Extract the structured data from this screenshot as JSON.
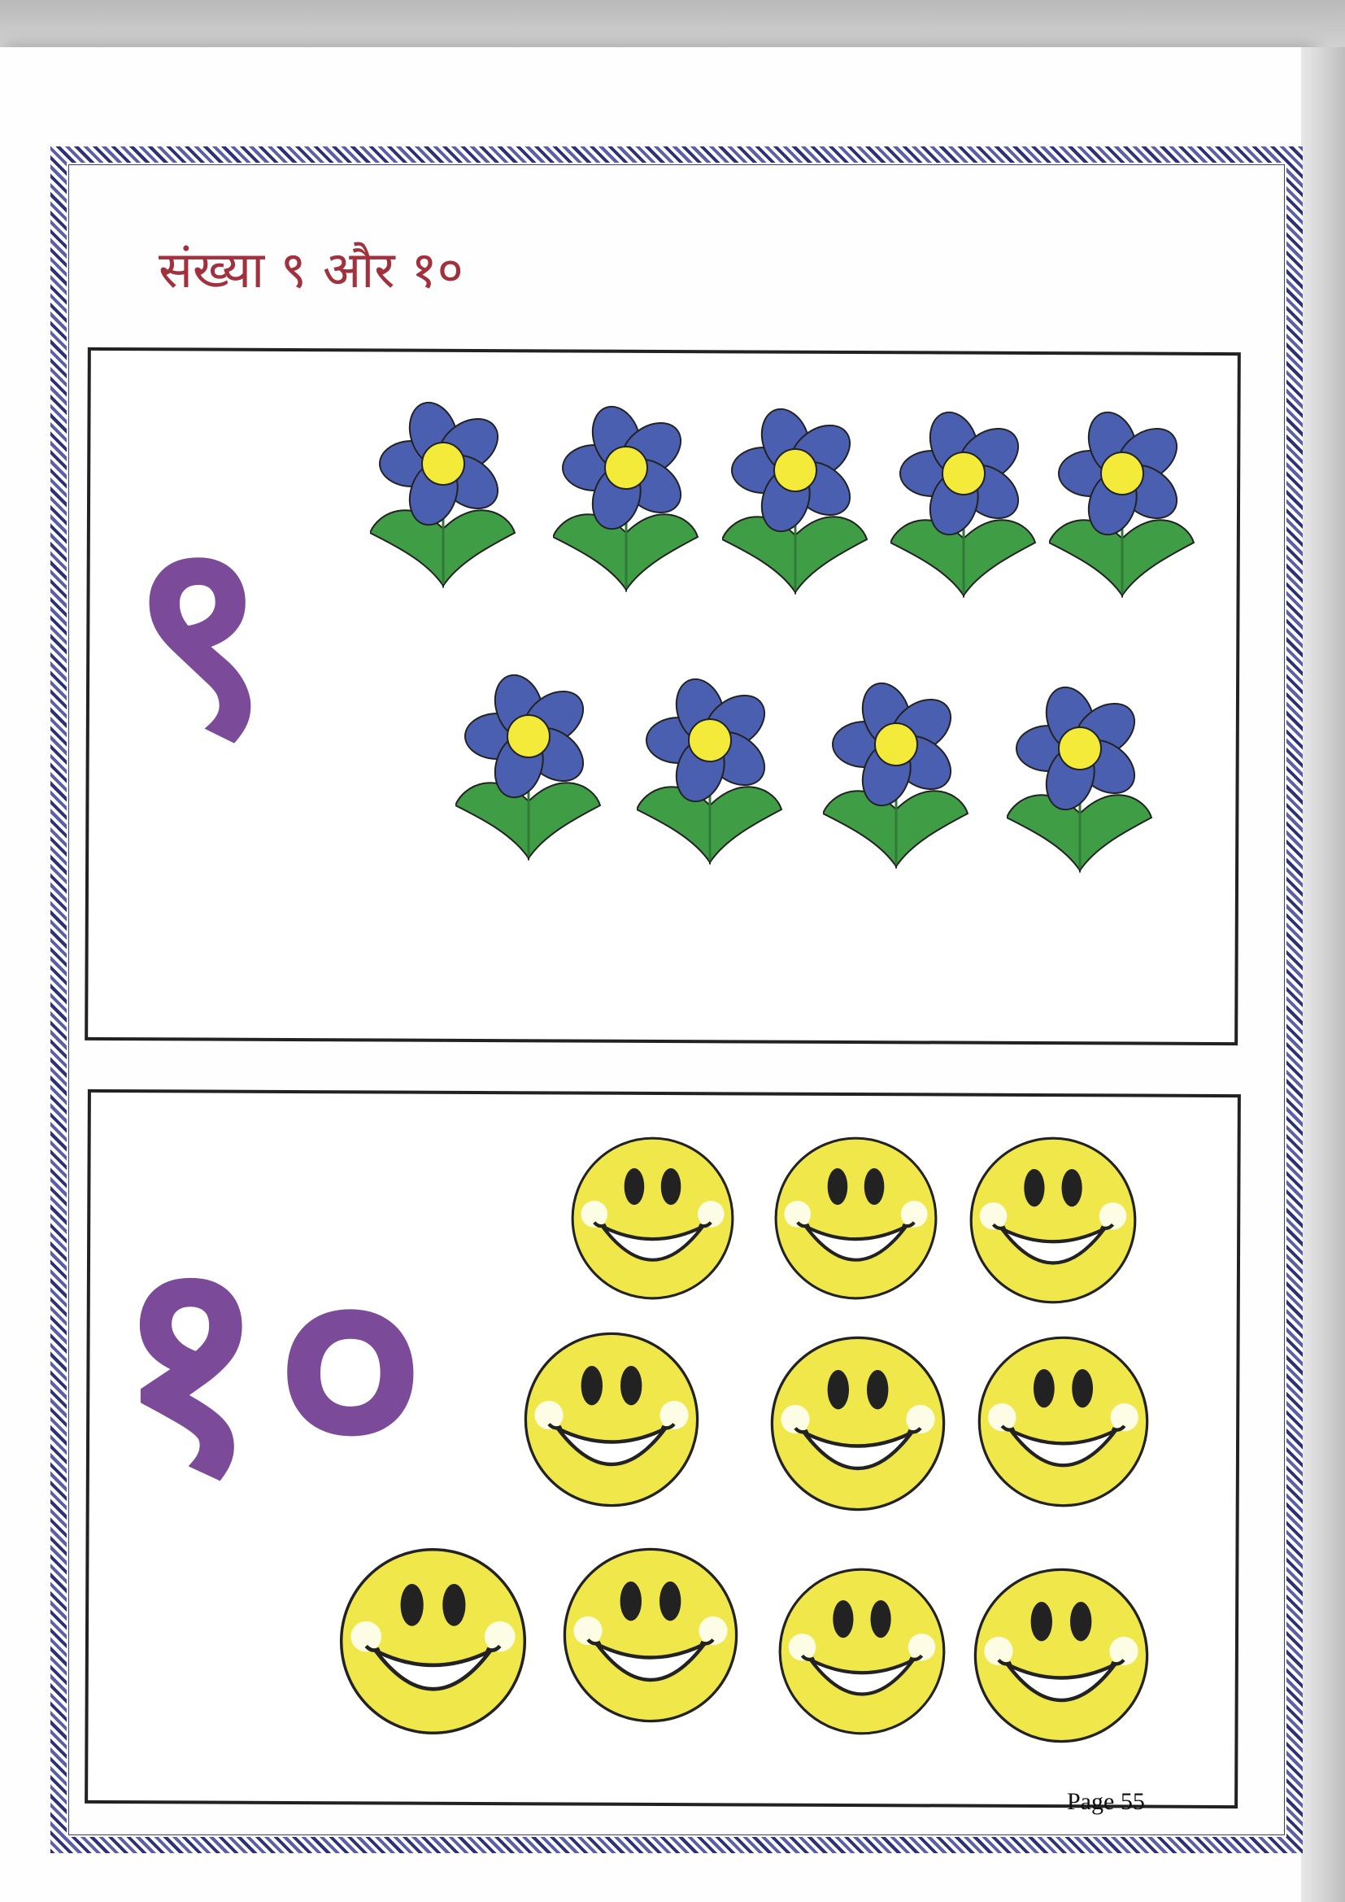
{
  "title": "संख्या ९ और १०",
  "section_nine": {
    "numeral": "९",
    "object": "flower",
    "count": 9
  },
  "section_ten": {
    "numeral": "१०",
    "object": "smiley-face",
    "count": 10
  },
  "footer": {
    "page_label": "Page  55"
  },
  "colors": {
    "title": "#a1313d",
    "numeral": "#7b4a98",
    "petal": "#4a5fb0",
    "flower_center": "#f3ea3a",
    "leaf": "#3f9d45",
    "smiley": "#f0e84a",
    "border": "#3b3f8a"
  }
}
